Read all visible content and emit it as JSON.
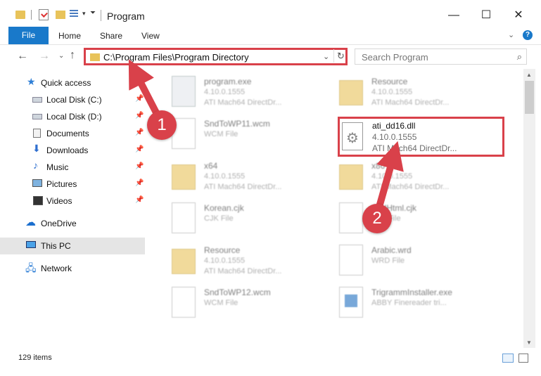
{
  "window": {
    "title": "Program",
    "minimize": "—",
    "maximize": "☐",
    "close": "✕"
  },
  "ribbon": {
    "file_tab": "File",
    "tabs": [
      "Home",
      "Share",
      "View"
    ],
    "expand": "⌄",
    "help": "?"
  },
  "navbar": {
    "back": "←",
    "forward": "→",
    "recent": "⌄",
    "up": "↑",
    "address": "C:\\Program Files\\Program Directory",
    "address_dropdown": "⌄",
    "refresh": "↻",
    "search_placeholder": "Search Program",
    "search_icon": "⌕"
  },
  "sidebar": {
    "items": [
      {
        "label": "Quick access",
        "icon": "star-icon"
      },
      {
        "label": "Local Disk (C:)",
        "icon": "disk-icon"
      },
      {
        "label": "Local Disk (D:)",
        "icon": "disk-icon"
      },
      {
        "label": "Documents",
        "icon": "document-icon"
      },
      {
        "label": "Downloads",
        "icon": "download-icon"
      },
      {
        "label": "Music",
        "icon": "music-icon"
      },
      {
        "label": "Pictures",
        "icon": "pictures-icon"
      },
      {
        "label": "Videos",
        "icon": "videos-icon"
      },
      {
        "label": "OneDrive",
        "icon": "cloud-icon"
      },
      {
        "label": "This PC",
        "icon": "pc-icon"
      },
      {
        "label": "Network",
        "icon": "network-icon"
      }
    ]
  },
  "files": {
    "left": [
      {
        "name": "program.exe",
        "line1": "4.10.0.1555",
        "line2": "ATI Mach64 DirectDr..."
      },
      {
        "name": "SndToWP11.wcm",
        "line1": "WCM File",
        "line2": ""
      },
      {
        "name": "x64",
        "line1": "4.10.0.1555",
        "line2": "ATI Mach64 DirectDr..."
      },
      {
        "name": "Korean.cjk",
        "line1": "CJK File",
        "line2": ""
      },
      {
        "name": "Resource",
        "line1": "4.10.0.1555",
        "line2": "ATI Mach64 DirectDr..."
      },
      {
        "name": "SndToWP12.wcm",
        "line1": "WCM File",
        "line2": ""
      }
    ],
    "right": [
      {
        "name": "Resource",
        "line1": "4.10.0.1555",
        "line2": "ATI Mach64 DirectDr..."
      },
      {
        "name": "ati_dd16.dll",
        "line1": "4.10.0.1555",
        "line2": "ATI Mach64 DirectDr..."
      },
      {
        "name": "x86",
        "line1": "4.10.0.1555",
        "line2": "ATI Mach64 DirectDr..."
      },
      {
        "name": "AddHtml.cjk",
        "line1": "CJK File",
        "line2": ""
      },
      {
        "name": "Arabic.wrd",
        "line1": "WRD File",
        "line2": ""
      },
      {
        "name": "TrigrammInstaller.exe",
        "line1": "ABBY Finereader tri...",
        "line2": ""
      }
    ]
  },
  "annotations": {
    "step1": "1",
    "step2": "2",
    "color": "#d9414a"
  },
  "status": {
    "item_count": "129 items"
  }
}
